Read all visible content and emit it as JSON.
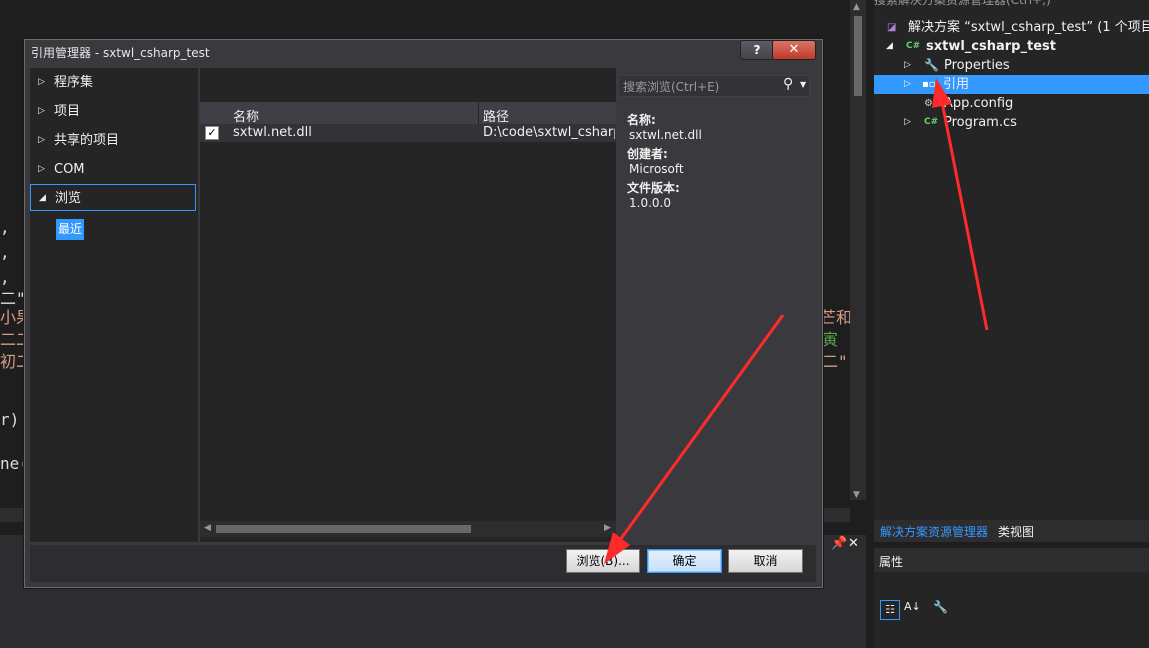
{
  "dialog": {
    "title": "引用管理器 - sxtwl_csharp_test",
    "help_label": "?",
    "close_label": "✕",
    "nav": [
      {
        "label": "程序集"
      },
      {
        "label": "项目"
      },
      {
        "label": "共享的项目"
      },
      {
        "label": "COM"
      },
      {
        "label": "浏览"
      }
    ],
    "nav_sub": "最近",
    "search_placeholder": "搜索浏览(Ctrl+E)",
    "columns": {
      "name": "名称",
      "path": "路径"
    },
    "rows": [
      {
        "name": "sxtwl.net.dll",
        "path": "D:\\code\\sxtwl_csharp_test",
        "checked": true
      }
    ],
    "details": {
      "name_label": "名称:",
      "name_value": "sxtwl.net.dll",
      "creator_label": "创建者:",
      "creator_value": "Microsoft",
      "version_label": "文件版本:",
      "version_value": "1.0.0.0"
    },
    "buttons": {
      "browse": "浏览(B)...",
      "ok": "确定",
      "cancel": "取消"
    }
  },
  "solution_explorer": {
    "search_text": "搜索解决方案资源管理器(Ctrl+;)",
    "items": [
      {
        "label": "解决方案 “sxtwl_csharp_test” (1 个项目)"
      },
      {
        "label": "sxtwl_csharp_test"
      },
      {
        "label": "Properties"
      },
      {
        "label": "引用"
      },
      {
        "label": "App.config"
      },
      {
        "label": "Program.cs"
      }
    ],
    "tabs": [
      "解决方案资源管理器",
      "类视图"
    ]
  },
  "properties": {
    "title": "属性"
  },
  "editor_fragments": {
    "comma1": ",",
    "comma2": ",",
    "comma3": ",",
    "quote": "二\"",
    "frag_xiao": "小果",
    "frag_er1": "二二",
    "frag_er2": "初二",
    "frag_paren": "r)",
    "frag_ne": "ne(",
    "frag_r1": "芒和",
    "frag_r2": "寅",
    "frag_r3": "二\""
  },
  "colors": {
    "accent": "#3399ff",
    "annotation": "#ff2a2a"
  }
}
